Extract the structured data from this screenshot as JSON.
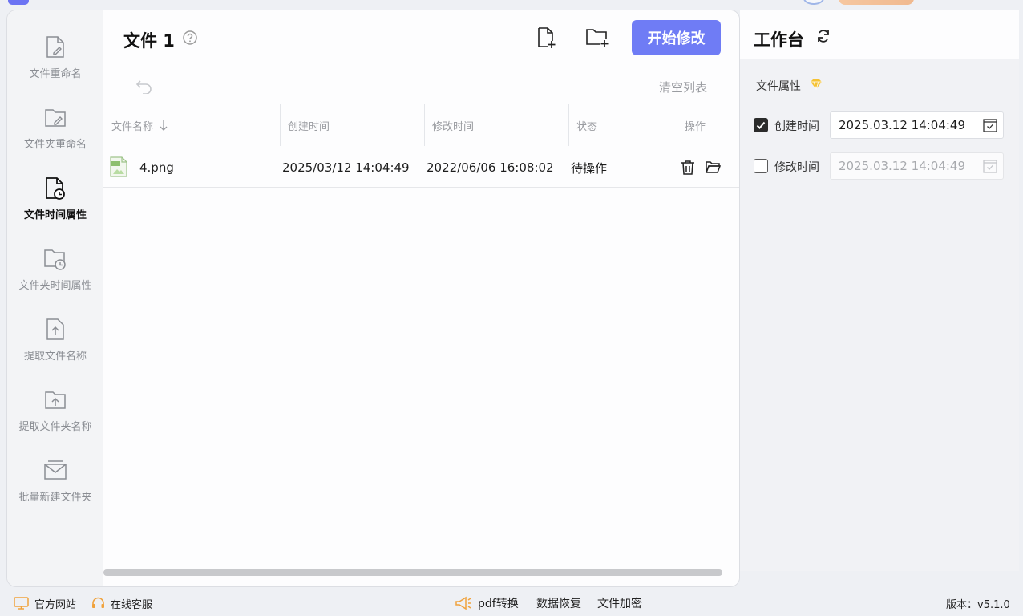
{
  "sidebar": {
    "items": [
      {
        "label": "文件重命名",
        "icon": "file-edit-icon"
      },
      {
        "label": "文件夹重命名",
        "icon": "folder-edit-icon"
      },
      {
        "label": "文件时间属性",
        "icon": "file-clock-icon",
        "active": true
      },
      {
        "label": "文件夹时间属性",
        "icon": "folder-clock-icon"
      },
      {
        "label": "提取文件名称",
        "icon": "file-upload-icon"
      },
      {
        "label": "提取文件夹名称",
        "icon": "folder-upload-icon"
      },
      {
        "label": "批量新建文件夹",
        "icon": "folder-stack-icon"
      }
    ]
  },
  "main": {
    "title": "文件 1",
    "start_button": "开始修改",
    "clear_list": "清空列表",
    "table": {
      "headers": [
        "文件名称",
        "创建时间",
        "修改时间",
        "状态",
        "操作"
      ],
      "rows": [
        {
          "name": "4.png",
          "created": "2025/03/12 14:04:49",
          "modified": "2022/06/06 16:08:02",
          "status": "待操作"
        }
      ]
    }
  },
  "right": {
    "title": "工作台",
    "section_label": "文件属性",
    "create_time": {
      "label": "创建时间",
      "value": "2025.03.12 14:04:49",
      "checked": true
    },
    "modify_time": {
      "label": "修改时间",
      "value": "2025.03.12 14:04:49",
      "checked": false
    }
  },
  "footer": {
    "official_site": "官方网站",
    "online_service": "在线客服",
    "pdf_convert": "pdf转换",
    "data_recovery": "数据恢复",
    "file_encrypt": "文件加密",
    "version": "版本：v5.1.0"
  },
  "colors": {
    "accent": "#6f7cf5",
    "badge": "#f5c233",
    "footer_icon": "#f0a23c"
  }
}
